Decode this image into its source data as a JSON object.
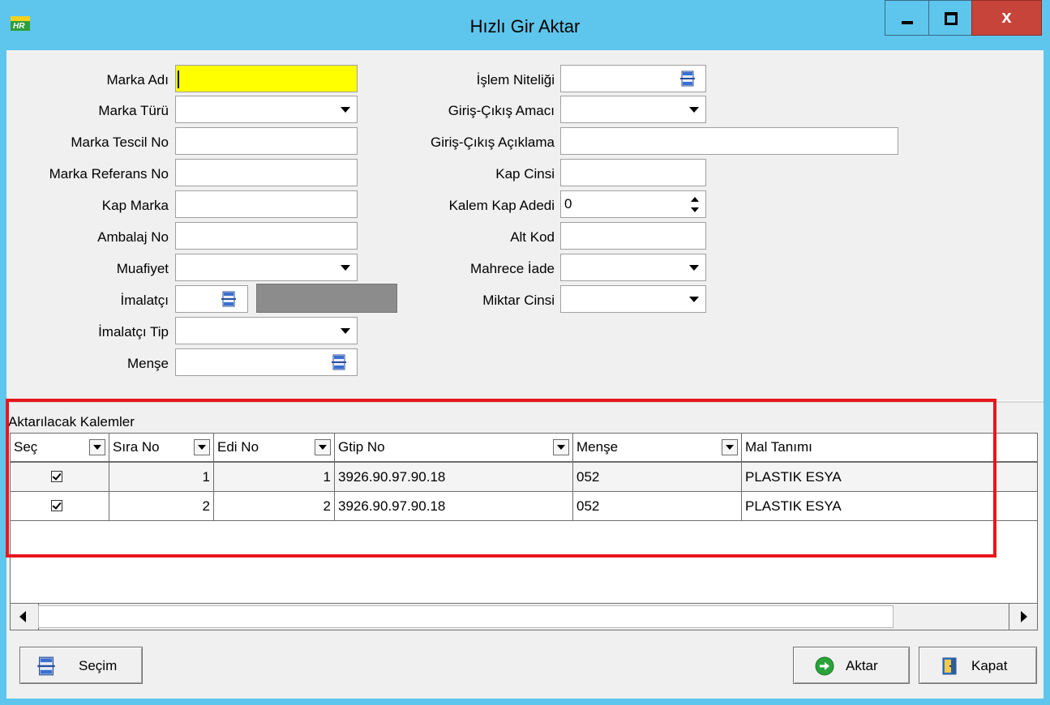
{
  "window": {
    "title": "Hızlı Gir Aktar",
    "close_label": "x"
  },
  "form": {
    "left": [
      {
        "label": "Marka Adı",
        "value": "",
        "type": "text-focused"
      },
      {
        "label": "Marka Türü",
        "value": "",
        "type": "dropdown"
      },
      {
        "label": "Marka Tescil No",
        "value": "",
        "type": "text"
      },
      {
        "label": "Marka Referans No",
        "value": "",
        "type": "text"
      },
      {
        "label": "Kap Marka",
        "value": "",
        "type": "text"
      },
      {
        "label": "Ambalaj No",
        "value": "",
        "type": "text"
      },
      {
        "label": "Muafiyet",
        "value": "",
        "type": "dropdown"
      },
      {
        "label": "İmalatçı",
        "value": "",
        "type": "lookup"
      },
      {
        "label": "İmalatçı Tip",
        "value": "",
        "type": "dropdown"
      },
      {
        "label": "Menşe",
        "value": "",
        "type": "lookup"
      }
    ],
    "right": [
      {
        "label": "İşlem Niteliği",
        "value": "",
        "type": "lookup"
      },
      {
        "label": "Giriş-Çıkış Amacı",
        "value": "",
        "type": "dropdown"
      },
      {
        "label": "Giriş-Çıkış Açıklama",
        "value": "",
        "type": "text"
      },
      {
        "label": "Kap Cinsi",
        "value": "",
        "type": "text"
      },
      {
        "label": "Kalem Kap Adedi",
        "value": "0",
        "type": "spinner"
      },
      {
        "label": "Alt Kod",
        "value": "",
        "type": "text"
      },
      {
        "label": "Mahrece İade",
        "value": "",
        "type": "dropdown"
      },
      {
        "label": "Miktar Cinsi",
        "value": "",
        "type": "dropdown"
      }
    ]
  },
  "grid": {
    "caption": "Aktarılacak Kalemler",
    "columns": [
      "Seç",
      "Sıra No",
      "Edi No",
      "Gtip No",
      "Menşe",
      "Mal Tanımı"
    ],
    "rows": [
      {
        "selected": true,
        "sira_no": "1",
        "edi_no": "1",
        "gtip_no": "3926.90.97.90.18",
        "mense": "052",
        "mal_tanimi": "PLASTIK ESYA"
      },
      {
        "selected": true,
        "sira_no": "2",
        "edi_no": "2",
        "gtip_no": "3926.90.97.90.18",
        "mense": "052",
        "mal_tanimi": "PLASTIK ESYA"
      }
    ]
  },
  "buttons": {
    "secim": "Seçim",
    "aktar": "Aktar",
    "kapat": "Kapat"
  },
  "colors": {
    "titlebar": "#5ec6ec",
    "close_button": "#c7443a",
    "focused_field": "#ffff00",
    "highlight_box": "#e8161e",
    "aktar_icon": "#2aa33a"
  },
  "icons": {
    "app": "app-logo-icon",
    "lookup": "lookup-picker-icon",
    "secim": "lookup-picker-icon",
    "aktar": "arrow-right-circle-icon",
    "kapat": "exit-door-icon"
  }
}
